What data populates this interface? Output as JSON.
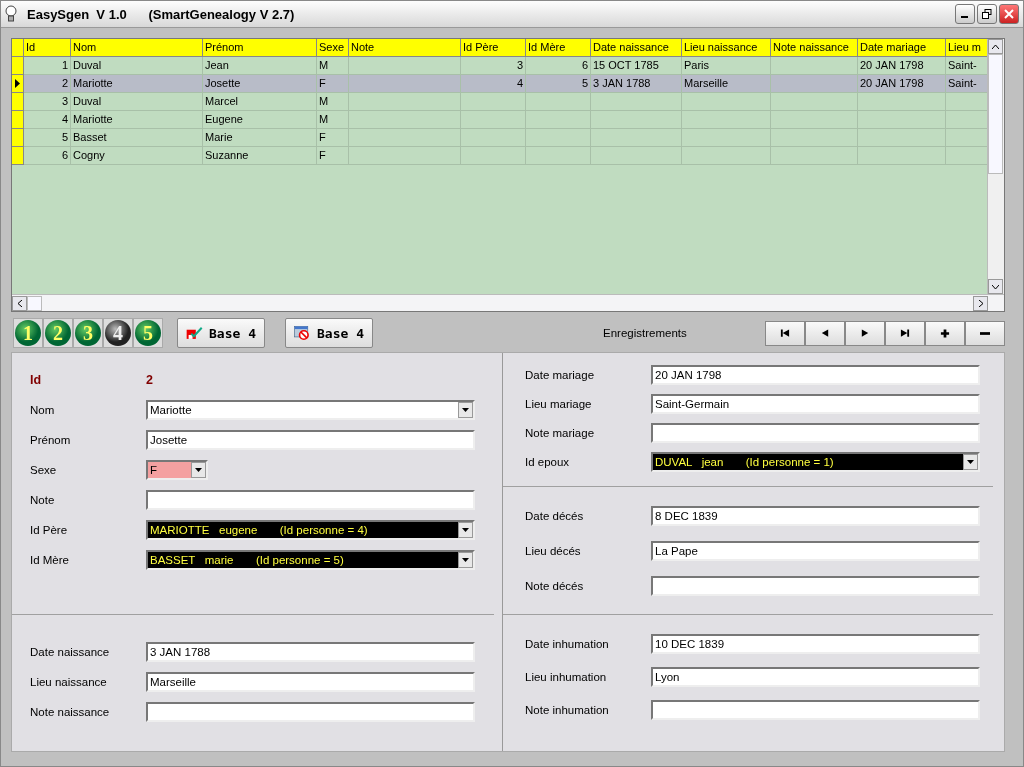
{
  "window": {
    "title": "EasySgen  V 1.0      (SmartGenealogy V 2.7)"
  },
  "table": {
    "columns": [
      "Id",
      "Nom",
      "Prénom",
      "Sexe",
      "Note",
      "Id Père",
      "Id Mère",
      "Date naissance",
      "Lieu naissance",
      "Note naissance",
      "Date mariage",
      "Lieu m"
    ],
    "rows": [
      {
        "selected": false,
        "cells": [
          "1",
          "Duval",
          "Jean",
          "M",
          "",
          "3",
          "6",
          "15 OCT 1785",
          "Paris",
          "",
          "20 JAN 1798",
          "Saint-"
        ]
      },
      {
        "selected": true,
        "cells": [
          "2",
          "Mariotte",
          "Josette",
          "F",
          "",
          "4",
          "5",
          "3 JAN 1788",
          "Marseille",
          "",
          "20 JAN 1798",
          "Saint-"
        ]
      },
      {
        "selected": false,
        "cells": [
          "3",
          "Duval",
          "Marcel",
          "M",
          "",
          "",
          "",
          "",
          "",
          "",
          "",
          ""
        ]
      },
      {
        "selected": false,
        "cells": [
          "4",
          "Mariotte",
          "Eugene",
          "M",
          "",
          "",
          "",
          "",
          "",
          "",
          "",
          ""
        ]
      },
      {
        "selected": false,
        "cells": [
          "5",
          "Basset",
          "Marie",
          "F",
          "",
          "",
          "",
          "",
          "",
          "",
          "",
          ""
        ]
      },
      {
        "selected": false,
        "cells": [
          "6",
          "Cogny",
          "Suzanne",
          "F",
          "",
          "",
          "",
          "",
          "",
          "",
          "",
          ""
        ]
      }
    ]
  },
  "databases": [
    {
      "label": "1",
      "selected": false
    },
    {
      "label": "2",
      "selected": false
    },
    {
      "label": "3",
      "selected": false
    },
    {
      "label": "4",
      "selected": true
    },
    {
      "label": "5",
      "selected": false
    }
  ],
  "actions": [
    {
      "kind": "save",
      "label": "Base 4"
    },
    {
      "kind": "cancel",
      "label": "Base 4"
    }
  ],
  "records_label": "Enregistrements",
  "navigator": [
    {
      "kind": "first"
    },
    {
      "kind": "prev"
    },
    {
      "kind": "next"
    },
    {
      "kind": "last"
    },
    {
      "kind": "add"
    },
    {
      "kind": "remove"
    }
  ],
  "form": {
    "left": [
      {
        "fields": [
          {
            "kind": "id",
            "label": "Id",
            "value": "2"
          },
          {
            "kind": "combo",
            "label": "Nom",
            "value": "Mariotte"
          },
          {
            "kind": "text",
            "label": "Prénom",
            "value": "Josette"
          },
          {
            "kind": "sex",
            "label": "Sexe",
            "value": "F"
          },
          {
            "kind": "text",
            "label": "Note"
          },
          {
            "kind": "person",
            "label": "Id Père",
            "value": "MARIOTTE   eugene       (Id personne = 4)"
          },
          {
            "kind": "person",
            "label": "Id Mère",
            "value": "BASSET   marie       (Id personne = 5)"
          }
        ]
      },
      {
        "fields": [
          {
            "kind": "text",
            "label": "Date naissance",
            "value": "3 JAN 1788"
          },
          {
            "kind": "text",
            "label": "Lieu naissance",
            "value": "Marseille"
          },
          {
            "kind": "text",
            "label": "Note naissance"
          }
        ]
      }
    ],
    "right": [
      {
        "fields": [
          {
            "kind": "text",
            "label": "Date mariage",
            "value": "20 JAN 1798"
          },
          {
            "kind": "text",
            "label": "Lieu mariage",
            "value": "Saint-Germain"
          },
          {
            "kind": "text",
            "label": "Note mariage"
          },
          {
            "kind": "person",
            "label": "Id epoux",
            "value": "DUVAL   jean       (Id personne = 1)"
          }
        ]
      },
      {
        "fields": [
          {
            "kind": "text",
            "label": "Date décés",
            "value": "8 DEC 1839"
          },
          {
            "kind": "text",
            "label": "Lieu décés",
            "value": "La Pape"
          },
          {
            "kind": "text",
            "label": "Note décés"
          }
        ]
      },
      {
        "fields": [
          {
            "kind": "text",
            "label": "Date inhumation",
            "value": "10 DEC 1839"
          },
          {
            "kind": "text",
            "label": "Lieu inhumation",
            "value": "Lyon"
          },
          {
            "kind": "text",
            "label": "Note inhumation"
          }
        ]
      }
    ]
  }
}
